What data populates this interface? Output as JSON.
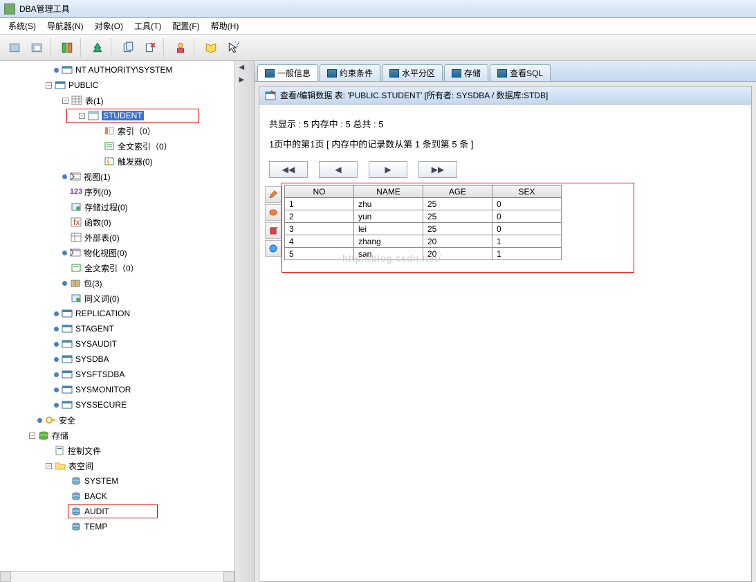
{
  "window": {
    "title": "DBA管理工具"
  },
  "menu": [
    "系统(S)",
    "导航器(N)",
    "对象(O)",
    "工具(T)",
    "配置(F)",
    "帮助(H)"
  ],
  "tree": {
    "ntauth": "NT AUTHORITY\\SYSTEM",
    "public": "PUBLIC",
    "tables": "表(1)",
    "student": "STUDENT",
    "index": "索引（0）",
    "fulltext_index": "全文索引（0）",
    "trigger": "触发器(0)",
    "views": "视图(1)",
    "sequences": "序列(0)",
    "procedures": "存储过程(0)",
    "functions": "函数(0)",
    "ext_tables": "外部表(0)",
    "mat_views": "物化视图(0)",
    "ft_index2": "全文索引（0）",
    "packages": "包(3)",
    "synonyms": "同义词(0)",
    "replication": "REPLICATION",
    "stagent": "STAGENT",
    "sysaudit": "SYSAUDIT",
    "sysdba": "SYSDBA",
    "sysftsdba": "SYSFTSDBA",
    "sysmonitor": "SYSMONITOR",
    "syssecure": "SYSSECURE",
    "security": "安全",
    "storage": "存储",
    "control_files": "控制文件",
    "tablespace": "表空间",
    "ts_system": "SYSTEM",
    "ts_back": "BACK",
    "ts_audit": "AUDIT",
    "ts_temp": "TEMP"
  },
  "tabs": [
    "一般信息",
    "约束条件",
    "水平分区",
    "存储",
    "查看SQL"
  ],
  "subheader": "查看/编辑数据  表: 'PUBLIC.STUDENT'  [所有者: SYSDBA / 数据库:STDB]",
  "info1": "共显示 : 5   内存中 : 5   总共 : 5",
  "info2": "1页中的第1页 [ 内存中的记录数从第 1 条到第 5 条 ]",
  "table": {
    "columns": [
      "NO",
      "NAME",
      "AGE",
      "SEX"
    ],
    "rows": [
      [
        "1",
        "zhu",
        "25",
        "0"
      ],
      [
        "2",
        "yun",
        "25",
        "0"
      ],
      [
        "3",
        "lei",
        "25",
        "0"
      ],
      [
        "4",
        "zhang",
        "20",
        "1"
      ],
      [
        "5",
        "san",
        "20",
        "1"
      ]
    ]
  },
  "watermark": "http://blog.csdn.net/"
}
